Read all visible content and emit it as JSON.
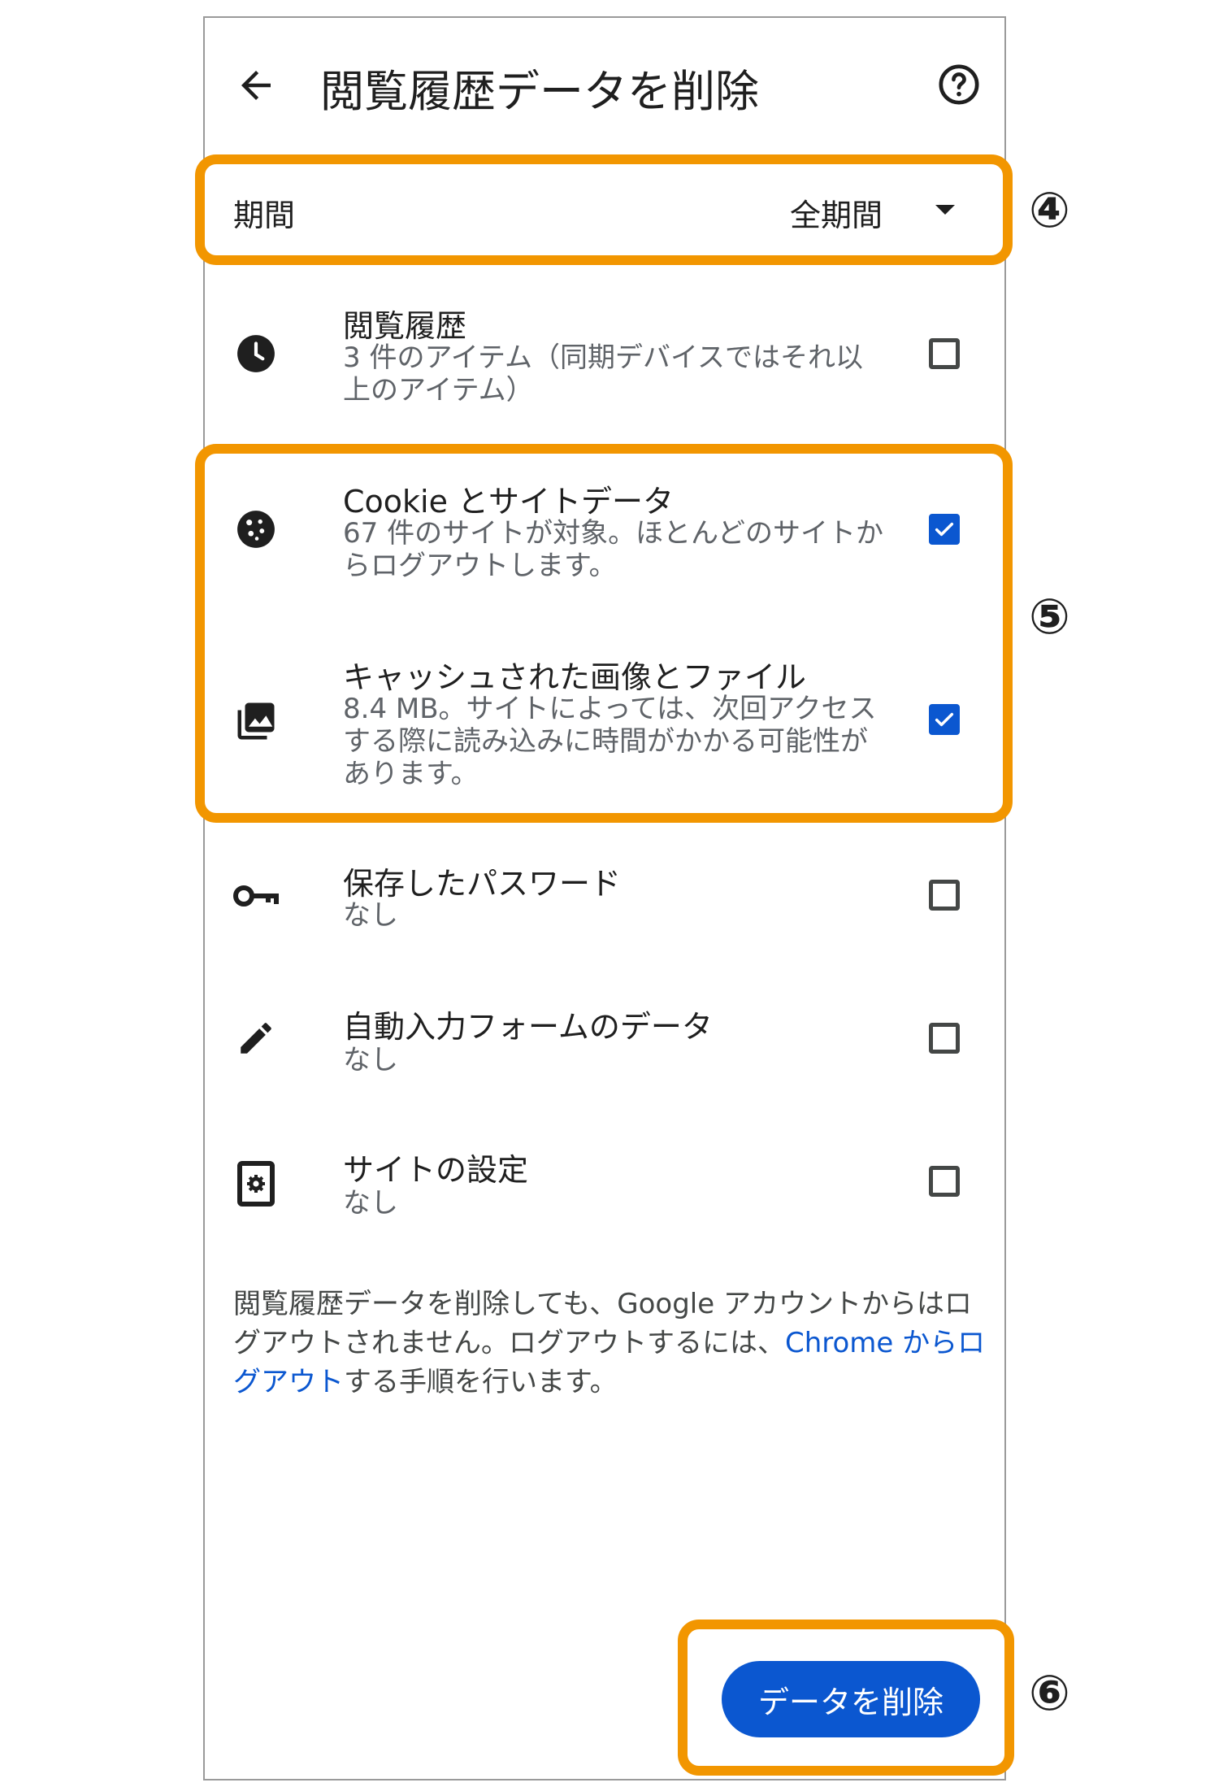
{
  "header": {
    "title": "閲覧履歴データを削除"
  },
  "period": {
    "label": "期間",
    "value": "全期間"
  },
  "items": [
    {
      "title": "閲覧履歴",
      "sub1": "3 件のアイテム（同期デバイスではそれ以",
      "sub2": "上のアイテム）",
      "icon": "clock-icon",
      "checked": false
    },
    {
      "title": "Cookie とサイトデータ",
      "sub1": "67 件のサイトが対象。ほとんどのサイトか",
      "sub2": "らログアウトします。",
      "icon": "cookie-icon",
      "checked": true
    },
    {
      "title": "キャッシュされた画像とファイル",
      "sub1": "8.4 MB。サイトによっては、次回アクセス",
      "sub2": "する際に読み込みに時間がかかる可能性が",
      "sub3": "あります。",
      "icon": "images-icon",
      "checked": true
    },
    {
      "title": "保存したパスワード",
      "sub1": "なし",
      "icon": "key-icon",
      "checked": false
    },
    {
      "title": "自動入力フォームのデータ",
      "sub1": "なし",
      "icon": "pencil-icon",
      "checked": false
    },
    {
      "title": "サイトの設定",
      "sub1": "なし",
      "icon": "site-settings-icon",
      "checked": false
    }
  ],
  "note": {
    "line1": "閲覧履歴データを削除しても、Google アカウントからはロ",
    "line2_a": "グアウトされません。ログアウトするには、",
    "line2_link": "Chrome からロ",
    "line3_link": "グアウト",
    "line3_b": "する手順を行います。"
  },
  "delete_button": "データを削除",
  "markers": {
    "m4": "④",
    "m5": "⑤",
    "m6": "⑥"
  },
  "colors": {
    "accent": "#0b57d0",
    "highlight": "#f29600"
  }
}
